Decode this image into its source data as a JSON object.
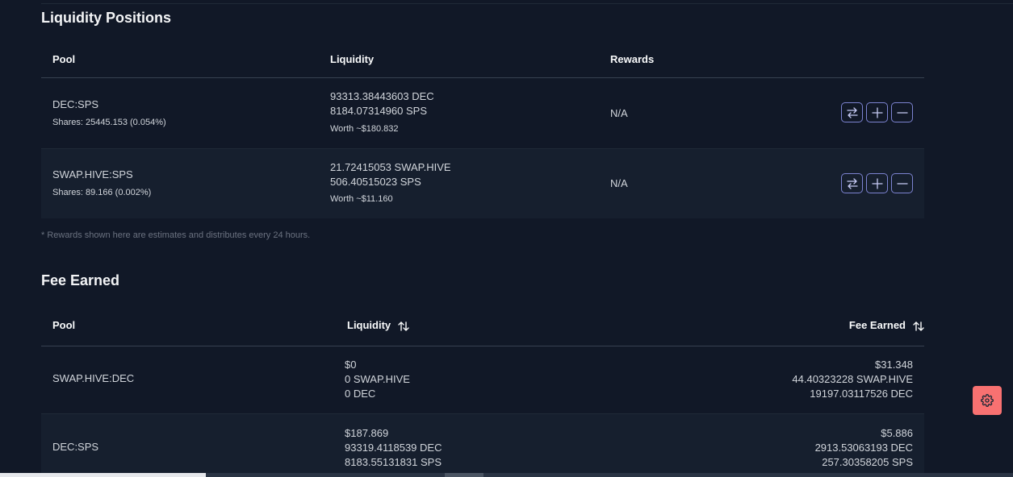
{
  "liquidity_positions": {
    "title": "Liquidity Positions",
    "headers": {
      "pool": "Pool",
      "liquidity": "Liquidity",
      "rewards": "Rewards"
    },
    "rows": [
      {
        "pool": "DEC:SPS",
        "shares": "Shares: 25445.153 (0.054%)",
        "liquidity_line1": "93313.38443603 DEC",
        "liquidity_line2": "8184.07314960 SPS",
        "worth": "Worth ~$180.832",
        "rewards": "N/A"
      },
      {
        "pool": "SWAP.HIVE:SPS",
        "shares": "Shares: 89.166 (0.002%)",
        "liquidity_line1": "21.72415053 SWAP.HIVE",
        "liquidity_line2": "506.40515023 SPS",
        "worth": "Worth ~$11.160",
        "rewards": "N/A"
      }
    ],
    "actions": [
      "swap-icon",
      "plus-icon",
      "minus-icon"
    ],
    "note": "* Rewards shown here are estimates and distributes every 24 hours."
  },
  "fee_earned": {
    "title": "Fee Earned",
    "headers": {
      "pool": "Pool",
      "liquidity": "Liquidity",
      "fee_earned": "Fee Earned"
    },
    "rows": [
      {
        "pool": "SWAP.HIVE:DEC",
        "liquidity": [
          "$0",
          "0 SWAP.HIVE",
          "0 DEC"
        ],
        "fee": [
          "$31.348",
          "44.40323228 SWAP.HIVE",
          "19197.03117526 DEC"
        ]
      },
      {
        "pool": "DEC:SPS",
        "liquidity": [
          "$187.869",
          "93319.4118539 DEC",
          "8183.55131831 SPS"
        ],
        "fee": [
          "$5.886",
          "2913.53063193 DEC",
          "257.30358205 SPS"
        ]
      }
    ]
  },
  "colors": {
    "background": "#111827",
    "alt_row": "#161f2e",
    "button_border": "#7c83d1",
    "settings_button": "#f87171"
  },
  "icons": {
    "sort": "sort-icon",
    "settings": "gear-icon"
  }
}
